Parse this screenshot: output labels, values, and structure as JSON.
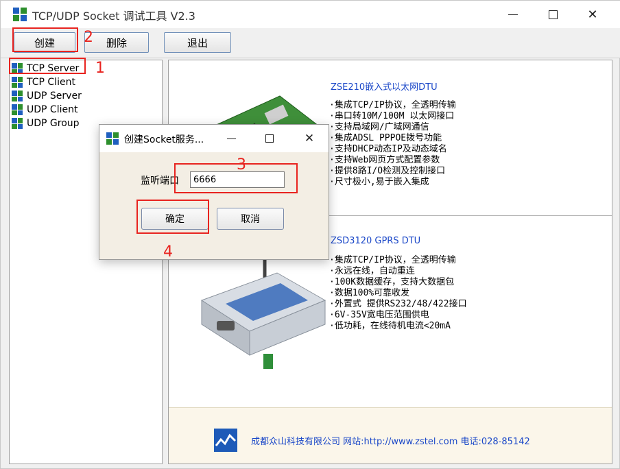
{
  "window": {
    "title": "TCP/UDP Socket 调试工具 V2.3",
    "minimize": "−",
    "maximize": "□",
    "close": "✕"
  },
  "toolbar": {
    "create_label": "创建",
    "delete_label": "删除",
    "exit_label": "退出"
  },
  "tree": {
    "items": [
      {
        "label": "TCP Server"
      },
      {
        "label": "TCP Client"
      },
      {
        "label": "UDP Server"
      },
      {
        "label": "UDP Client"
      },
      {
        "label": "UDP Group"
      }
    ]
  },
  "products": [
    {
      "title": "ZSE210嵌入式以太网DTU",
      "features": [
        "·集成TCP/IP协议，全透明传输",
        "·串口转10M/100M 以太网接口",
        "·支持局域网/广域网通信",
        "·集成ADSL PPPOE拨号功能",
        "·支持DHCP动态IP及动态域名",
        "·支持Web网页方式配置参数",
        "·提供8路I/O检测及控制接口",
        "·尺寸极小,易于嵌入集成"
      ]
    },
    {
      "title": "ZSD3120 GPRS DTU",
      "features": [
        "·集成TCP/IP协议，全透明传输",
        "·永远在线，自动重连",
        "·100K数据缓存，支持大数据包",
        "·数据100%可靠收发",
        "·外置式 提供RS232/48/422接口",
        "·6V-35V宽电压范围供电",
        "·低功耗，在线待机电流<20mA"
      ]
    }
  ],
  "footer": {
    "text": "成都众山科技有限公司  网站:http://www.zstel.com   电话:028-85142"
  },
  "dialog": {
    "title": "创建Socket服务...",
    "port_label": "监听端口",
    "port_value": "6666",
    "ok_label": "确定",
    "cancel_label": "取消"
  },
  "annotations": [
    "1",
    "2",
    "3",
    "4"
  ],
  "colors": {
    "annotation": "#e8231f",
    "link_blue": "#1a47c8",
    "footer_bg": "#fbf6ea",
    "dialog_bg": "#f3eee4"
  }
}
